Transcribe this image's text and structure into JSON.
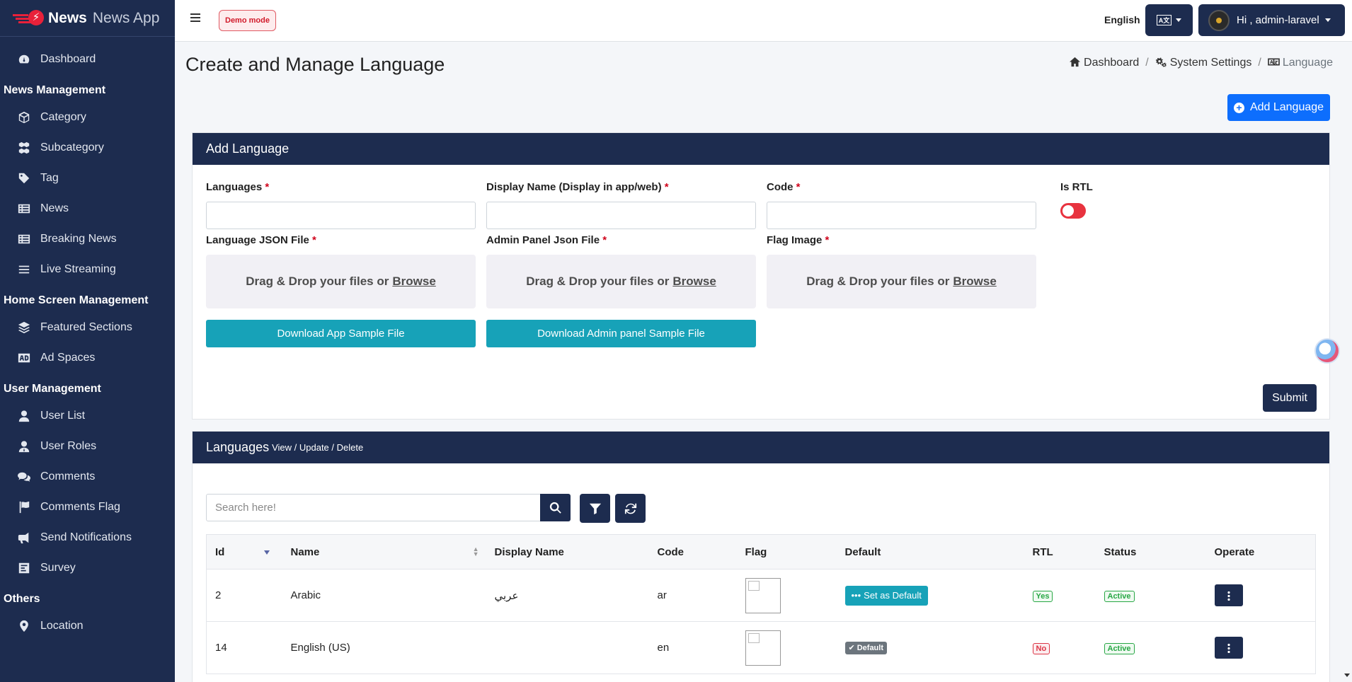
{
  "brand": {
    "name": "News",
    "app": "News App"
  },
  "sidebar": {
    "dashboard": "Dashboard",
    "news_management": {
      "header": "News Management",
      "items": [
        "Category",
        "Subcategory",
        "Tag",
        "News",
        "Breaking News",
        "Live Streaming"
      ]
    },
    "home_screen_management": {
      "header": "Home Screen Management",
      "items": [
        "Featured Sections",
        "Ad Spaces"
      ]
    },
    "user_management": {
      "header": "User Management",
      "items": [
        "User List",
        "User Roles",
        "Comments",
        "Comments Flag",
        "Send Notifications",
        "Survey"
      ]
    },
    "others": {
      "header": "Others",
      "items": [
        "Location"
      ]
    }
  },
  "topbar": {
    "demo_badge": "Demo mode",
    "language": "English",
    "user_greeting": "Hi , admin-laravel"
  },
  "page": {
    "title": "Create and Manage Language",
    "breadcrumb": [
      "Dashboard",
      "System Settings",
      "Language"
    ],
    "add_button": "Add Language"
  },
  "add_form": {
    "title": "Add Language",
    "languages_label": "Languages",
    "display_name_label": "Display Name (Display in app/web)",
    "code_label": "Code",
    "is_rtl_label": "Is RTL",
    "is_rtl_checked": false,
    "required_mark": "*",
    "language_json_label": "Language JSON File",
    "admin_json_label": "Admin Panel Json File",
    "flag_image_label": "Flag Image",
    "dropzone_text": "Drag & Drop your files or",
    "dropzone_browse": "Browse",
    "download_app_sample": "Download App Sample File",
    "download_admin_sample": "Download Admin panel Sample File",
    "submit": "Submit"
  },
  "languages_table": {
    "title": "Languages",
    "subtitle": "View / Update / Delete",
    "search_placeholder": "Search here!",
    "columns": [
      "Id",
      "Name",
      "Display Name",
      "Code",
      "Flag",
      "Default",
      "RTL",
      "Status",
      "Operate"
    ],
    "rows": [
      {
        "id": "2",
        "name": "Arabic",
        "display_name": "عربي",
        "code": "ar",
        "default": "Set as Default",
        "rtl": "Yes",
        "status": "Active"
      },
      {
        "id": "14",
        "name": "English (US)",
        "display_name": "",
        "code": "en",
        "default": "Default",
        "rtl": "No",
        "status": "Active"
      }
    ]
  },
  "colors": {
    "sidebar_bg": "#1d2c4f",
    "primary": "#0d6efd",
    "info": "#17a2b8",
    "danger": "#e8333f",
    "success": "#28a745"
  }
}
